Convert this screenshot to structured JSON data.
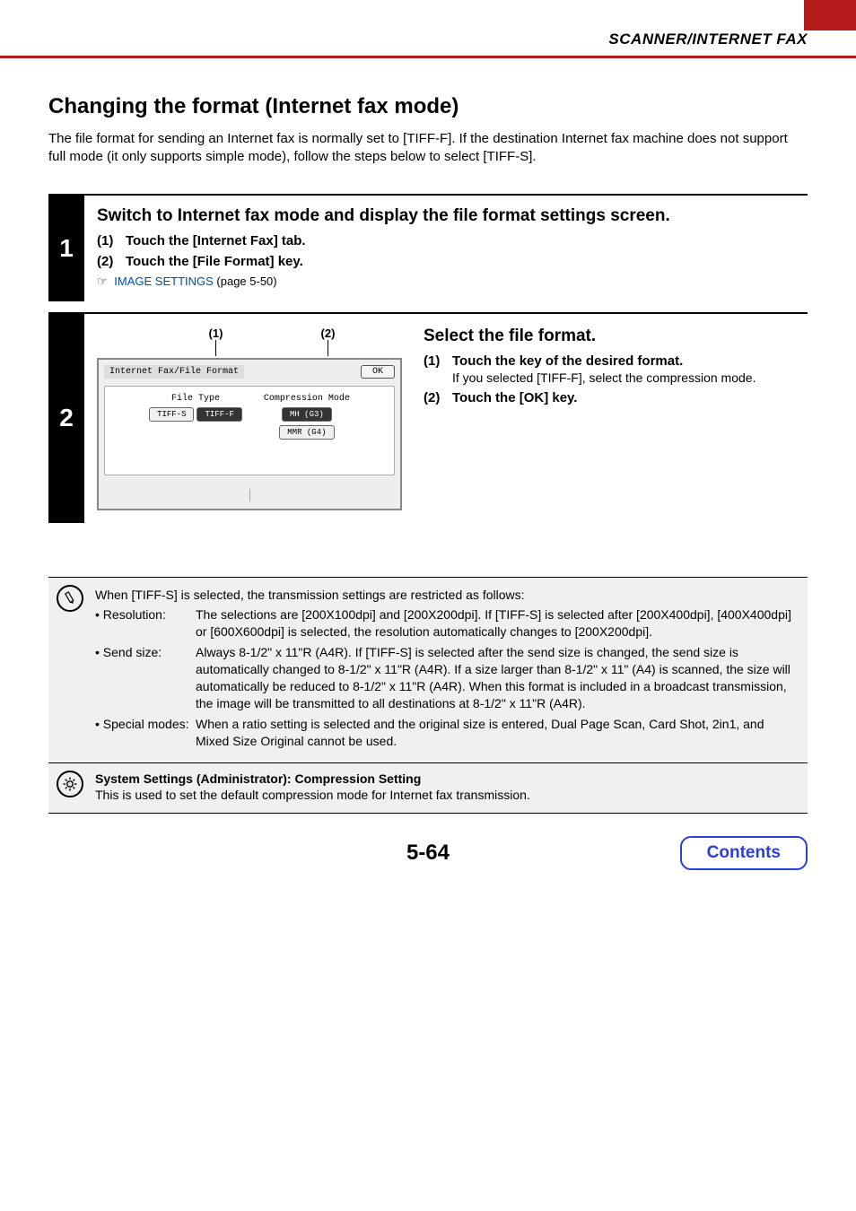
{
  "header": "SCANNER/INTERNET FAX",
  "title": "Changing the format (Internet fax mode)",
  "intro": "The file format for sending an Internet fax is normally set to [TIFF-F]. If the destination Internet fax machine does not support full mode (it only supports simple mode), follow the steps below to select [TIFF-S].",
  "step1": {
    "number": "1",
    "title": "Switch to Internet fax mode and display the file format settings screen.",
    "item1_num": "(1)",
    "item1_text": "Touch the [Internet Fax] tab.",
    "item2_num": "(2)",
    "item2_text": "Touch the [File Format] key.",
    "xref_icon": "☞",
    "xref_link": "IMAGE SETTINGS",
    "xref_suffix": " (page 5-50)"
  },
  "step2": {
    "number": "2",
    "callout1": "(1)",
    "callout2": "(2)",
    "panel": {
      "title": "Internet Fax/File Format",
      "ok": "OK",
      "file_type_label": "File Type",
      "tiff_s": "TIFF-S",
      "tiff_f": "TIFF-F",
      "comp_label": "Compression Mode",
      "mh": "MH (G3)",
      "mmr": "MMR (G4)"
    },
    "title": "Select the file format.",
    "item1_num": "(1)",
    "item1_text": "Touch the key of the desired format.",
    "item1_sub": "If you selected [TIFF-F], select the compression mode.",
    "item2_num": "(2)",
    "item2_text": "Touch the [OK] key."
  },
  "note": {
    "intro": "When [TIFF-S] is selected, the transmission settings are restricted as follows:",
    "row1_label": "• Resolution:",
    "row1_text": "The selections are [200X100dpi] and [200X200dpi]. If [TIFF-S] is selected after [200X400dpi], [400X400dpi] or [600X600dpi] is selected, the resolution automatically changes to [200X200dpi].",
    "row2_label": "• Send size:",
    "row2_text": "Always 8-1/2\" x 11\"R (A4R). If [TIFF-S] is selected after the send size is changed, the send size is automatically changed to 8-1/2\" x 11\"R (A4R). If a size larger than 8-1/2\" x 11\" (A4) is scanned, the size will automatically be reduced to 8-1/2\" x 11\"R (A4R). When this format is included in a broadcast transmission, the image will be transmitted to all destinations at 8-1/2\" x 11\"R (A4R).",
    "row3_label": "• Special modes:",
    "row3_text": "When a ratio setting is selected and the original size is entered, Dual Page Scan, Card Shot, 2in1, and Mixed Size Original cannot be used."
  },
  "admin": {
    "title": "System Settings (Administrator): Compression Setting",
    "desc": "This is used to set the default compression mode for Internet fax transmission."
  },
  "footer": {
    "page": "5-64",
    "contents": "Contents"
  }
}
